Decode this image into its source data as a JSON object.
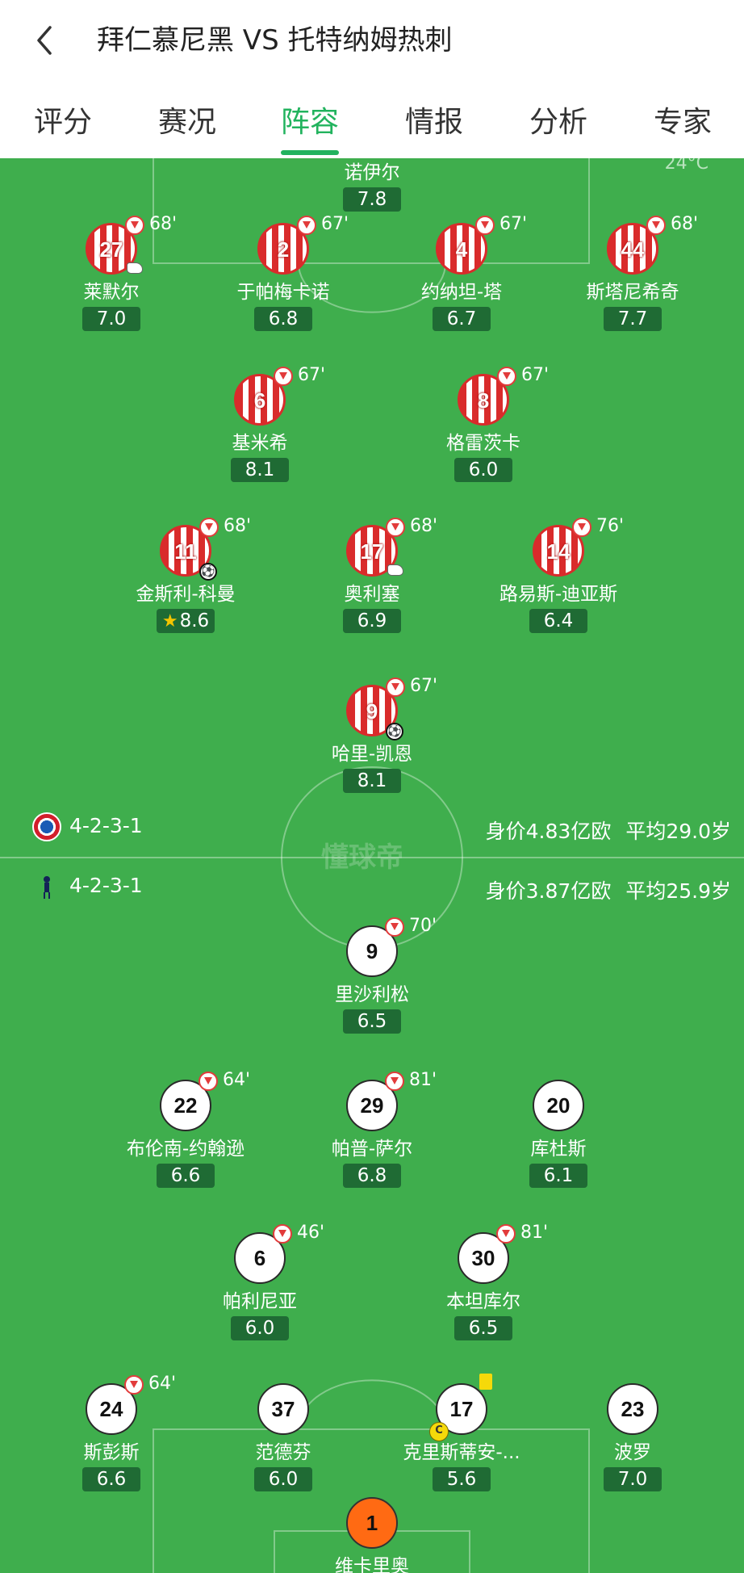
{
  "header": {
    "title": "拜仁慕尼黑 VS 托特纳姆热刺"
  },
  "tabs": [
    "评分",
    "赛况",
    "阵容",
    "情报",
    "分析",
    "专家"
  ],
  "active_tab": "阵容",
  "weather": "24°C",
  "watermark": "懂球帝",
  "home": {
    "formation": "4-2-3-1",
    "value": "身价4.83亿欧",
    "avg_age": "平均29.0岁",
    "players": [
      {
        "id": "gk",
        "name": "诺伊尔",
        "rating": "7.8"
      },
      {
        "id": "p27",
        "number": "27",
        "name": "莱默尔",
        "rating": "7.0",
        "sub": "68'",
        "assist": true
      },
      {
        "id": "p2",
        "number": "2",
        "name": "于帕梅卡诺",
        "rating": "6.8",
        "sub": "67'"
      },
      {
        "id": "p4",
        "number": "4",
        "name": "约纳坦-塔",
        "rating": "6.7",
        "sub": "67'"
      },
      {
        "id": "p44",
        "number": "44",
        "name": "斯塔尼希奇",
        "rating": "7.7",
        "sub": "68'"
      },
      {
        "id": "p6",
        "number": "6",
        "name": "基米希",
        "rating": "8.1",
        "sub": "67'"
      },
      {
        "id": "p8",
        "number": "8",
        "name": "格雷茨卡",
        "rating": "6.0",
        "sub": "67'"
      },
      {
        "id": "p11",
        "number": "11",
        "name": "金斯利-科曼",
        "rating": "8.6",
        "sub": "68'",
        "goal": true,
        "mvp": true
      },
      {
        "id": "p17",
        "number": "17",
        "name": "奥利塞",
        "rating": "6.9",
        "sub": "68'",
        "assist": true
      },
      {
        "id": "p14",
        "number": "14",
        "name": "路易斯-迪亚斯",
        "rating": "6.4",
        "sub": "76'"
      },
      {
        "id": "p9",
        "number": "9",
        "name": "哈里-凯恩",
        "rating": "8.1",
        "sub": "67'",
        "goal": true
      }
    ]
  },
  "away": {
    "formation": "4-2-3-1",
    "value": "身价3.87亿欧",
    "avg_age": "平均25.9岁",
    "players": [
      {
        "id": "a9",
        "number": "9",
        "name": "里沙利松",
        "rating": "6.5",
        "sub": "70'"
      },
      {
        "id": "a22",
        "number": "22",
        "name": "布伦南-约翰逊",
        "rating": "6.6",
        "sub": "64'"
      },
      {
        "id": "a29",
        "number": "29",
        "name": "帕普-萨尔",
        "rating": "6.8",
        "sub": "81'"
      },
      {
        "id": "a20",
        "number": "20",
        "name": "库杜斯",
        "rating": "6.1"
      },
      {
        "id": "a6",
        "number": "6",
        "name": "帕利尼亚",
        "rating": "6.0",
        "sub": "46'"
      },
      {
        "id": "a30",
        "number": "30",
        "name": "本坦库尔",
        "rating": "6.5",
        "sub": "81'"
      },
      {
        "id": "a24",
        "number": "24",
        "name": "斯彭斯",
        "rating": "6.6",
        "sub": "64'"
      },
      {
        "id": "a37",
        "number": "37",
        "name": "范德芬",
        "rating": "6.0"
      },
      {
        "id": "a17",
        "number": "17",
        "name": "克里斯蒂安-...",
        "rating": "5.6",
        "yellow": true,
        "captain": true,
        "captain_label": "C"
      },
      {
        "id": "a23",
        "number": "23",
        "name": "波罗",
        "rating": "7.0"
      },
      {
        "id": "agk",
        "number": "1",
        "name": "维卡里奥"
      }
    ]
  }
}
